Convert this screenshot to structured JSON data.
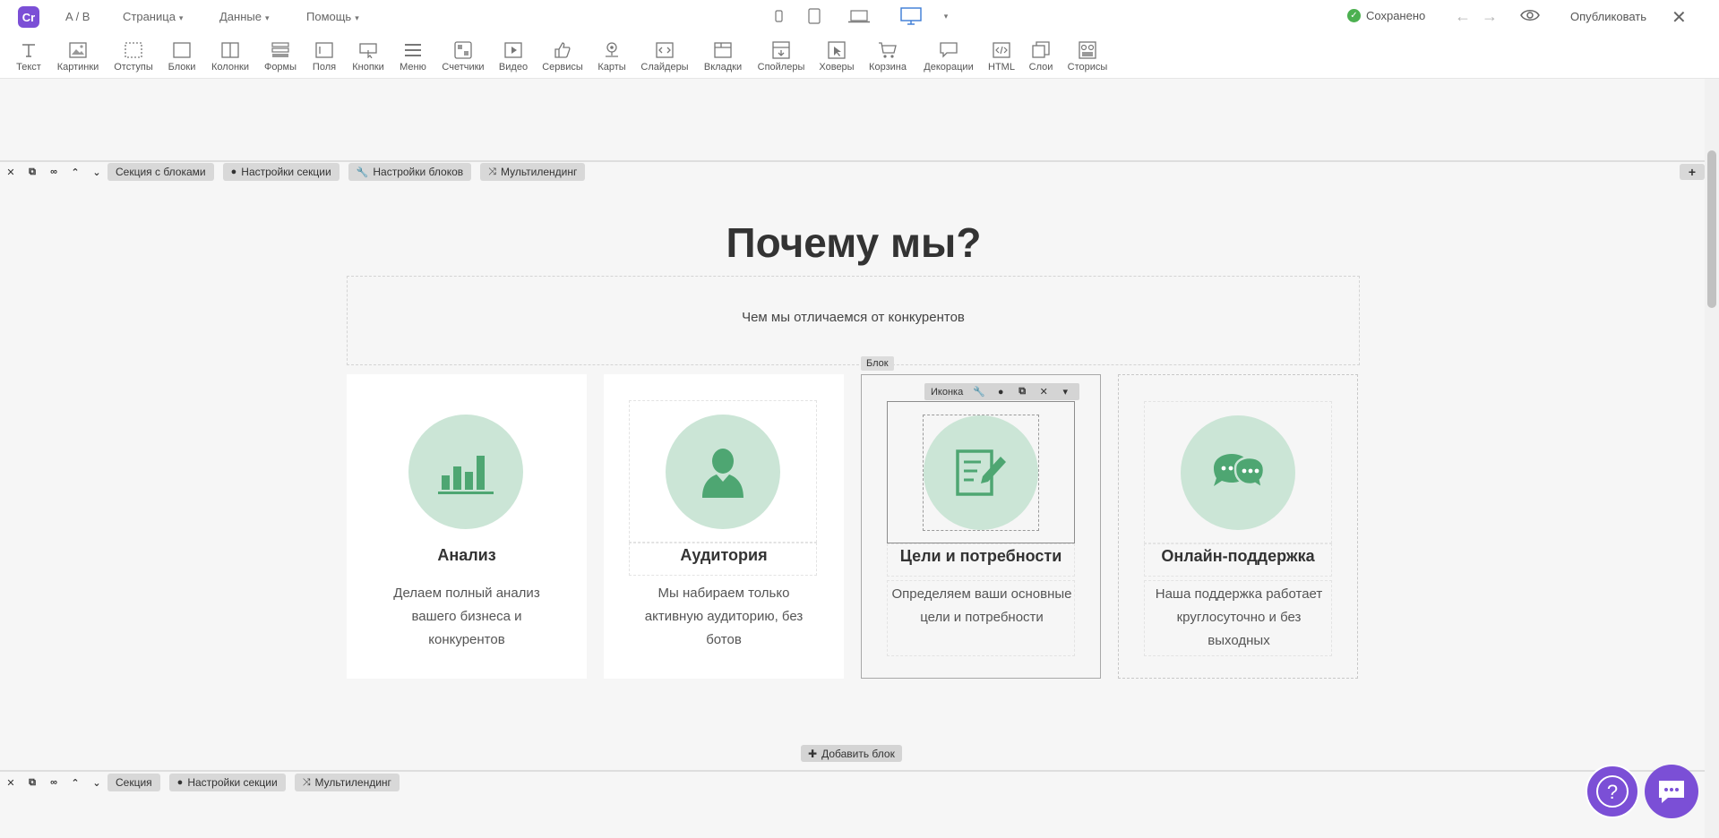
{
  "topbar": {
    "ab_label": "A / B",
    "menu_page": "Страница",
    "menu_data": "Данные",
    "menu_help": "Помощь",
    "saved_label": "Сохранено",
    "publish_label": "Опубликовать",
    "logo_text": "Cr"
  },
  "toolbar": {
    "items": [
      {
        "label": "Текст",
        "icon": "text-icon"
      },
      {
        "label": "Картинки",
        "icon": "image-icon"
      },
      {
        "label": "Отступы",
        "icon": "padding-icon"
      },
      {
        "label": "Блоки",
        "icon": "block-icon"
      },
      {
        "label": "Колонки",
        "icon": "columns-icon"
      },
      {
        "label": "Формы",
        "icon": "form-icon"
      },
      {
        "label": "Поля",
        "icon": "field-icon"
      },
      {
        "label": "Кнопки",
        "icon": "button-icon"
      },
      {
        "label": "Меню",
        "icon": "menu-icon"
      },
      {
        "label": "Счетчики",
        "icon": "counter-icon"
      },
      {
        "label": "Видео",
        "icon": "video-icon"
      },
      {
        "label": "Сервисы",
        "icon": "thumbs-up-icon"
      },
      {
        "label": "Карты",
        "icon": "map-pin-icon"
      },
      {
        "label": "Слайдеры",
        "icon": "slider-icon"
      },
      {
        "label": "Вкладки",
        "icon": "tabs-icon"
      },
      {
        "label": "Спойлеры",
        "icon": "spoiler-icon"
      },
      {
        "label": "Ховеры",
        "icon": "hover-icon"
      },
      {
        "label": "Корзина",
        "icon": "cart-icon"
      },
      {
        "label": "Декорации",
        "icon": "speech-bubble-icon"
      },
      {
        "label": "HTML",
        "icon": "code-icon"
      },
      {
        "label": "Слои",
        "icon": "layers-icon"
      },
      {
        "label": "Сторисы",
        "icon": "stories-icon"
      }
    ]
  },
  "section1": {
    "name": "Секция с блоками",
    "settings_label": "Настройки секции",
    "blocks_settings_label": "Настройки блоков",
    "multilanding_label": "Мультилендинг",
    "heading": "Почему мы?",
    "subtitle": "Чем мы отличаемся от конкурентов",
    "block_label": "Блок",
    "icon_toolbar_label": "Иконка",
    "add_block_label": "Добавить блок",
    "cards": [
      {
        "title": "Анализ",
        "text": "Делаем полный анализ вашего бизнеса и конкурентов",
        "icon": "bar-chart-icon"
      },
      {
        "title": "Аудитория",
        "text": "Мы набираем только активную аудиторию, без ботов",
        "icon": "user-icon"
      },
      {
        "title": "Цели и потребности",
        "text": "Определяем ваши основные цели и потребности",
        "icon": "document-edit-icon"
      },
      {
        "title": "Онлайн-поддержка",
        "text": "Наша поддержка работает круглосуточно и без выходных",
        "icon": "chat-bubbles-icon"
      }
    ]
  },
  "section2": {
    "name": "Секция",
    "settings_label": "Настройки секции",
    "multilanding_label": "Мультилендинг"
  },
  "colors": {
    "accent": "#7b4fd6",
    "icon_green": "#4ea672",
    "circle_bg": "#cbe5d6",
    "saved_green": "#4cb050"
  }
}
